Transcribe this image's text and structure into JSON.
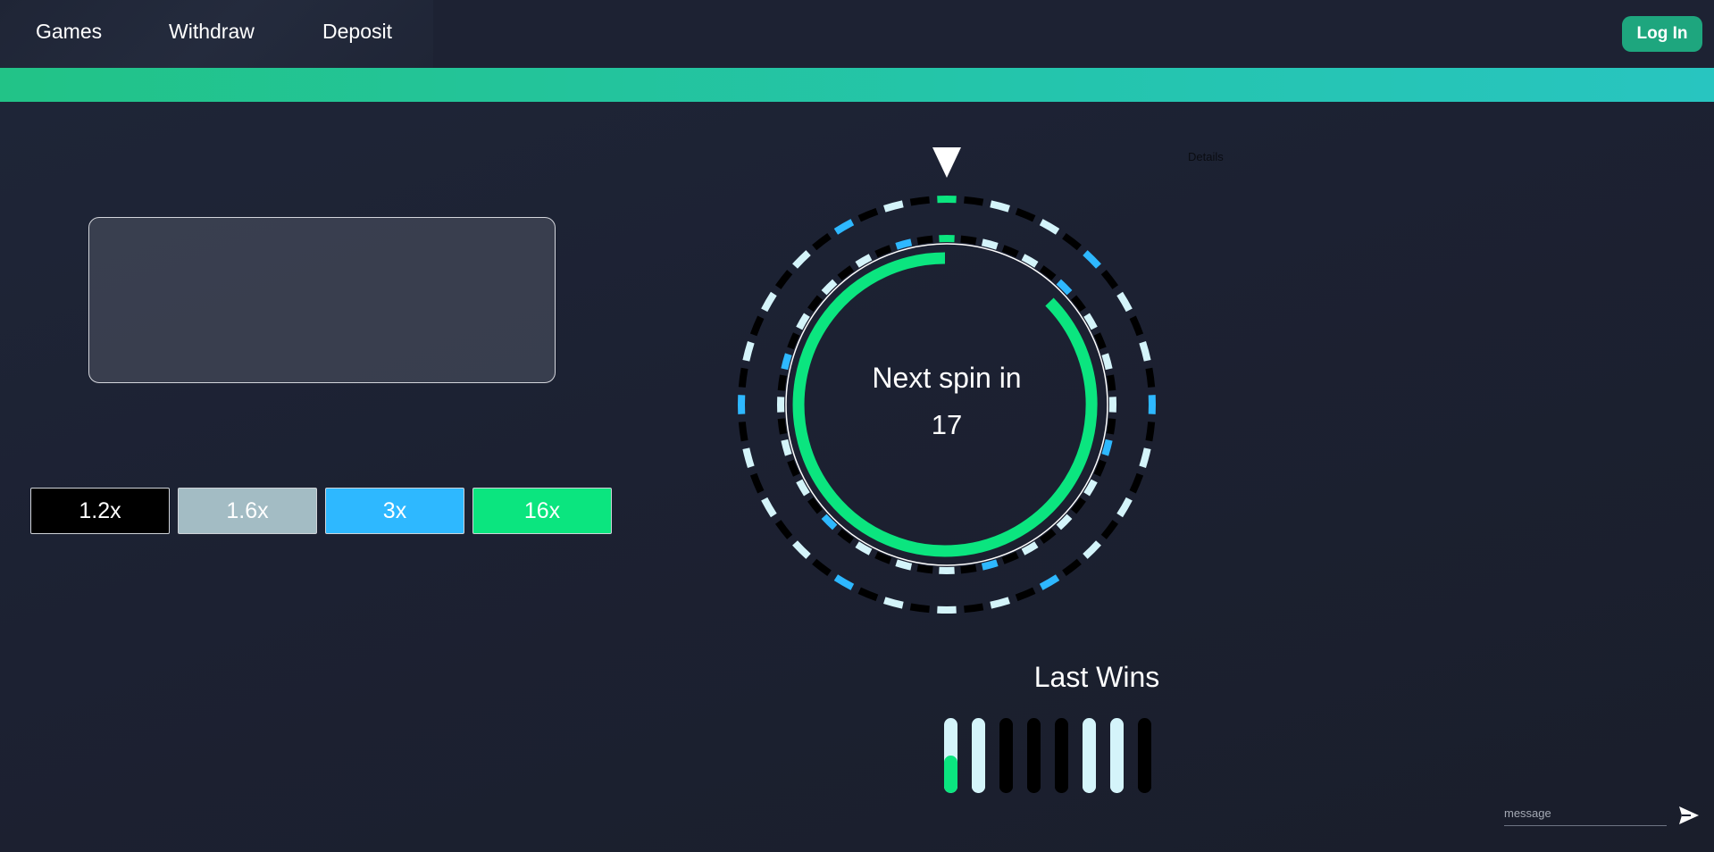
{
  "nav": {
    "items": [
      {
        "label": "Games"
      },
      {
        "label": "Withdraw"
      },
      {
        "label": "Deposit"
      }
    ],
    "login_label": "Log In"
  },
  "colors": {
    "accent_green": "#0be57f",
    "accent_teal": "#24c5ac",
    "blue": "#2eb8ff",
    "light": "#d4f4fa",
    "grey": "#a3bcc4",
    "black": "#000000"
  },
  "multipliers": [
    {
      "label": "1.2x",
      "color": "#000000"
    },
    {
      "label": "1.6x",
      "color": "#a3bcc4"
    },
    {
      "label": "3x",
      "color": "#2eb8ff"
    },
    {
      "label": "16x",
      "color": "#0be57f"
    }
  ],
  "details_label": "Details",
  "wheel": {
    "label": "Next spin in",
    "countdown": "17",
    "pointer_icon": "triangle-down-icon"
  },
  "last_wins": {
    "title": "Last Wins",
    "results": [
      "16x",
      "1.6x",
      "1.2x",
      "1.2x",
      "1.2x",
      "1.6x",
      "1.6x",
      "1.2x"
    ]
  },
  "chat": {
    "placeholder": "message",
    "send_icon": "send-icon"
  }
}
